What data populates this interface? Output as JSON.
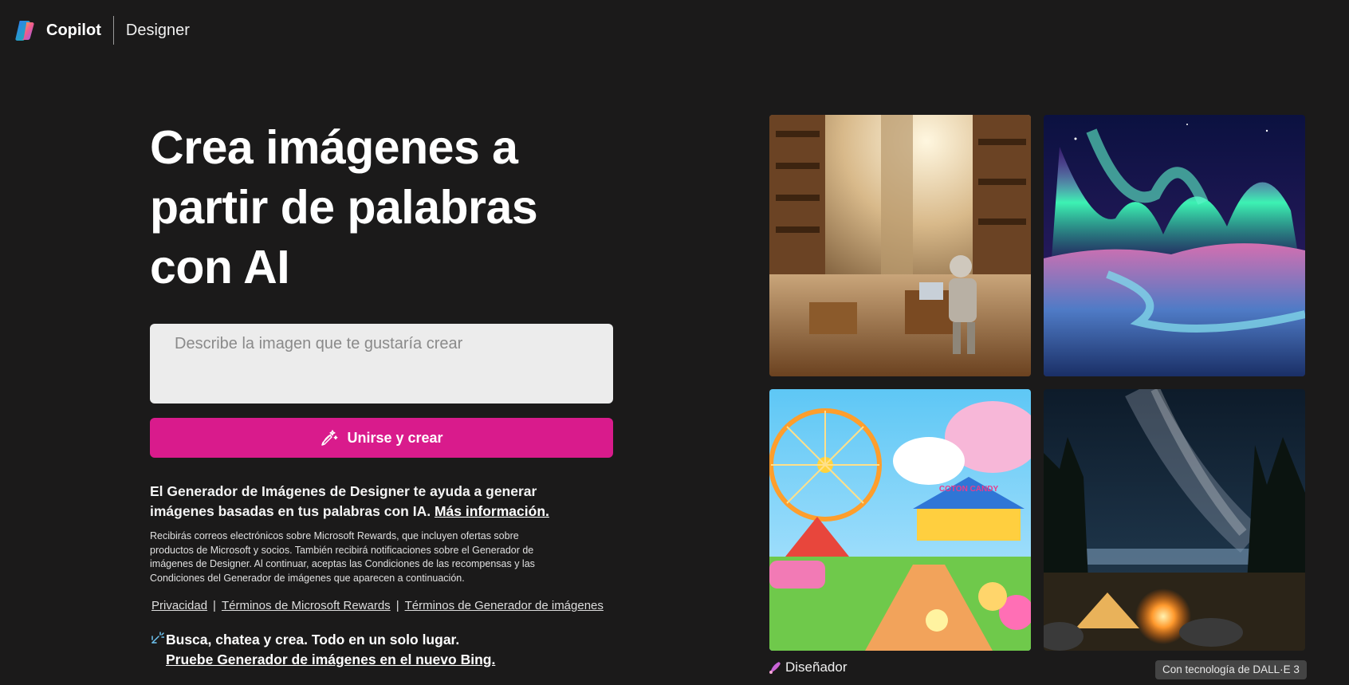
{
  "header": {
    "brand": "Copilot",
    "product": "Designer"
  },
  "hero": {
    "headline": "Crea imágenes a partir de palabras con AI",
    "prompt_placeholder": "Describe la imagen que te gustaría crear",
    "prompt_value": "",
    "create_button": "Unirse y crear"
  },
  "description": {
    "text": "El Generador de Imágenes de Designer te ayuda a generar imágenes basadas en tus palabras con IA.",
    "link": "Más información."
  },
  "fine_print": "Recibirás correos electrónicos sobre Microsoft Rewards, que incluyen ofertas sobre productos de Microsoft y socios. También recibirá notificaciones sobre el Generador de imágenes de Designer. Al continuar, aceptas las Condiciones de las recompensas y las Condiciones del Generador de imágenes que aparecen a continuación.",
  "links": {
    "privacy": "Privacidad",
    "rewards_terms": "Términos de Microsoft Rewards",
    "generator_terms": "Términos de Generador de imágenes",
    "separator": "|"
  },
  "promo": {
    "text": "Busca, chatea y crea. Todo en un solo lugar.",
    "link": "Pruebe Generador de imágenes en el nuevo Bing."
  },
  "gallery": {
    "footer_label": "Diseñador",
    "badge": "Con tecnología de DALL·E 3",
    "sign_text": "COTON CANDY"
  },
  "colors": {
    "background": "#1b1a1a",
    "accent": "#d91b8c",
    "input_bg": "#ececec"
  },
  "icons": [
    "copilot-logo-icon",
    "wand-sparkle-icon",
    "sparkle-icon",
    "designer-icon"
  ]
}
